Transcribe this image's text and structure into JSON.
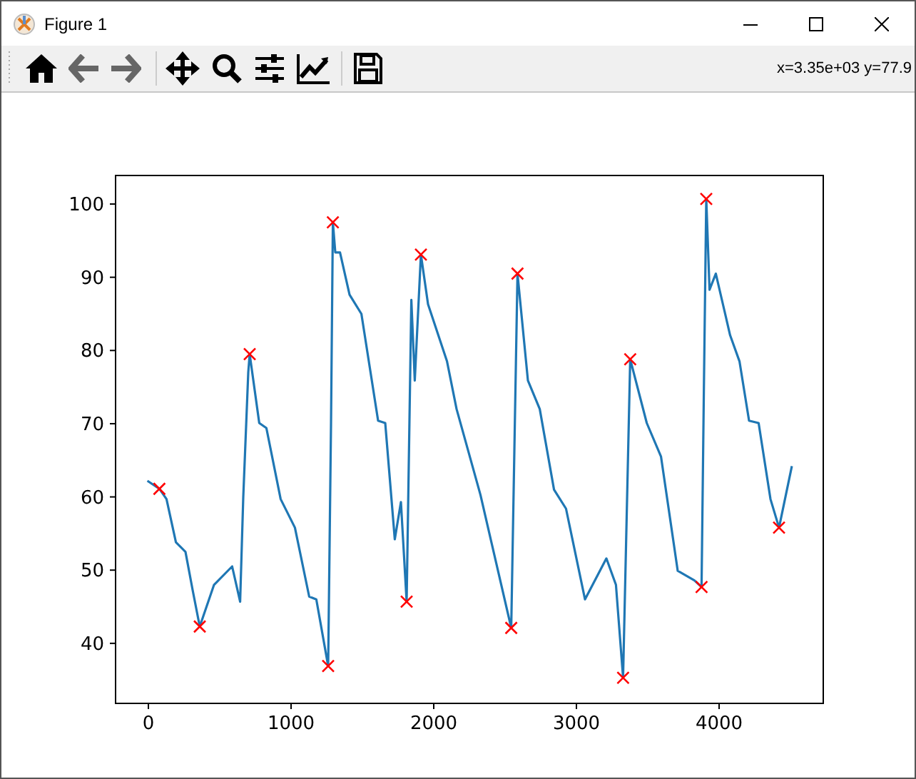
{
  "window": {
    "title": "Figure 1"
  },
  "toolbar": {
    "coordinates": "x=3.35e+03 y=77.9"
  },
  "figure": {
    "chart_data": {
      "type": "line",
      "xlim": [
        -230,
        4730
      ],
      "ylim": [
        31.8,
        103.9
      ],
      "xticks": [
        0,
        1000,
        2000,
        3000,
        4000
      ],
      "yticks": [
        40,
        50,
        60,
        70,
        80,
        90,
        100
      ],
      "x": [
        -7,
        77,
        127,
        193,
        260,
        310,
        360,
        460,
        587,
        643,
        665,
        700,
        710,
        777,
        827,
        927,
        1027,
        1127,
        1177,
        1260,
        1280,
        1293,
        1310,
        1343,
        1410,
        1493,
        1610,
        1660,
        1727,
        1770,
        1810,
        1843,
        1867,
        1910,
        1960,
        2093,
        2160,
        2327,
        2543,
        2565,
        2587,
        2660,
        2743,
        2843,
        2927,
        3060,
        3210,
        3277,
        3327,
        3352,
        3377,
        3493,
        3593,
        3710,
        3827,
        3877,
        3893,
        3910,
        3933,
        3977,
        4077,
        4143,
        4210,
        4277,
        4360,
        4420,
        4510
      ],
      "series": [
        {
          "color": "#1f77b4",
          "values": [
            62.2,
            61.1,
            59.7,
            53.8,
            52.5,
            47.3,
            42.3,
            48.0,
            50.5,
            45.7,
            60,
            77,
            79.5,
            70.1,
            69.4,
            59.7,
            55.8,
            46.4,
            46.0,
            36.9,
            70,
            97.5,
            93.4,
            93.4,
            87.6,
            85.0,
            70.4,
            70.1,
            54.2,
            59.3,
            45.7,
            86.9,
            75.9,
            93.1,
            86.3,
            78.5,
            72.0,
            60.3,
            42.1,
            66.3,
            90.5,
            75.9,
            72.0,
            61.0,
            58.4,
            46.0,
            51.6,
            48.0,
            35.3,
            57.1,
            78.8,
            70.1,
            65.5,
            49.9,
            48.6,
            47.7,
            74.2,
            100.7,
            88.3,
            90.5,
            82.1,
            78.5,
            70.4,
            70.1,
            59.7,
            55.8,
            64.2
          ]
        },
        {
          "color": "#ff0000",
          "marker": "x",
          "values": [
            null,
            61.1,
            null,
            null,
            null,
            null,
            42.3,
            null,
            null,
            null,
            null,
            null,
            79.5,
            null,
            null,
            null,
            null,
            null,
            null,
            36.9,
            null,
            97.5,
            null,
            null,
            null,
            null,
            null,
            null,
            null,
            null,
            45.7,
            null,
            null,
            93.1,
            null,
            null,
            null,
            null,
            42.1,
            null,
            90.5,
            null,
            null,
            null,
            null,
            null,
            null,
            null,
            35.3,
            null,
            78.8,
            null,
            null,
            null,
            null,
            47.7,
            null,
            100.7,
            null,
            null,
            null,
            null,
            null,
            null,
            null,
            55.8,
            null
          ]
        }
      ]
    }
  }
}
